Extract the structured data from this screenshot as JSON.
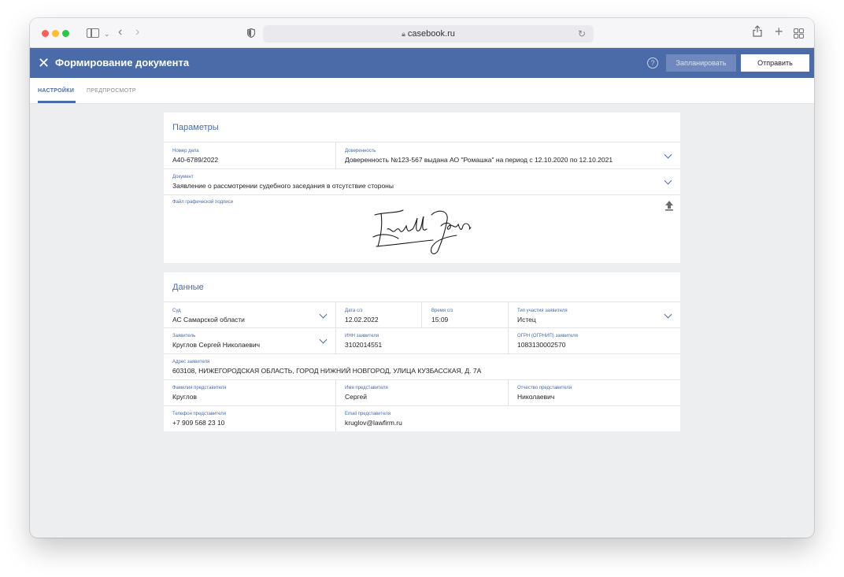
{
  "browser": {
    "url": "casebook.ru"
  },
  "app": {
    "title": "Формирование документа",
    "schedule_label": "Запланировать",
    "send_label": "Отправить"
  },
  "tabs": [
    {
      "label": "НАСТРОЙКИ",
      "active": true
    },
    {
      "label": "ПРЕДПРОСМОТР",
      "active": false
    }
  ],
  "params": {
    "title": "Параметры",
    "case_number": {
      "label": "Номер дела",
      "value": "А40-6789/2022"
    },
    "power_of_attorney": {
      "label": "Доверенность",
      "value": "Доверенность №123-567 выдана АО \"Ромашка\" на период с 12.10.2020 по 12.10.2021"
    },
    "document": {
      "label": "Документ",
      "value": "Заявление о рассмотрении судебного заседания в отсутствие стороны"
    },
    "signature": {
      "label": "Файл графической подписи"
    }
  },
  "data": {
    "title": "Данные",
    "court": {
      "label": "Суд",
      "value": "АС Самарской области"
    },
    "date": {
      "label": "Дата с/з",
      "value": "12.02.2022"
    },
    "time": {
      "label": "Время с/з",
      "value": "15:09"
    },
    "participation": {
      "label": "Тип участия заявителя",
      "value": "Истец"
    },
    "applicant": {
      "label": "Заявитель",
      "value": "Круглов Сергей Николаевич"
    },
    "inn": {
      "label": "ИНН заявителя",
      "value": "3102014551"
    },
    "ogrn": {
      "label": "ОГРН (ОГРНИП) заявителя",
      "value": "1083130002570"
    },
    "address": {
      "label": "Адрес заявителя",
      "value": "603108, НИЖЕГОРОДСКАЯ ОБЛАСТЬ, ГОРОД НИЖНИЙ НОВГОРОД, УЛИЦА КУЗБАССКАЯ, Д. 7А"
    },
    "rep_last_name": {
      "label": "Фамилия представителя",
      "value": "Круглов"
    },
    "rep_first_name": {
      "label": "Имя представителя",
      "value": "Сергей"
    },
    "rep_patronymic": {
      "label": "Отчество представителя",
      "value": "Николаевич"
    },
    "rep_phone": {
      "label": "Телефон представителя",
      "value": "+7 909 568 23 10"
    },
    "rep_email": {
      "label": "Email представителя",
      "value": "kruglov@lawfirm.ru"
    }
  },
  "colors": {
    "brand": "#4a6aa8",
    "background": "#eceef0"
  },
  "icons": [
    "close-icon",
    "help-icon",
    "chevron-down-icon",
    "upload-icon",
    "signature-image"
  ]
}
